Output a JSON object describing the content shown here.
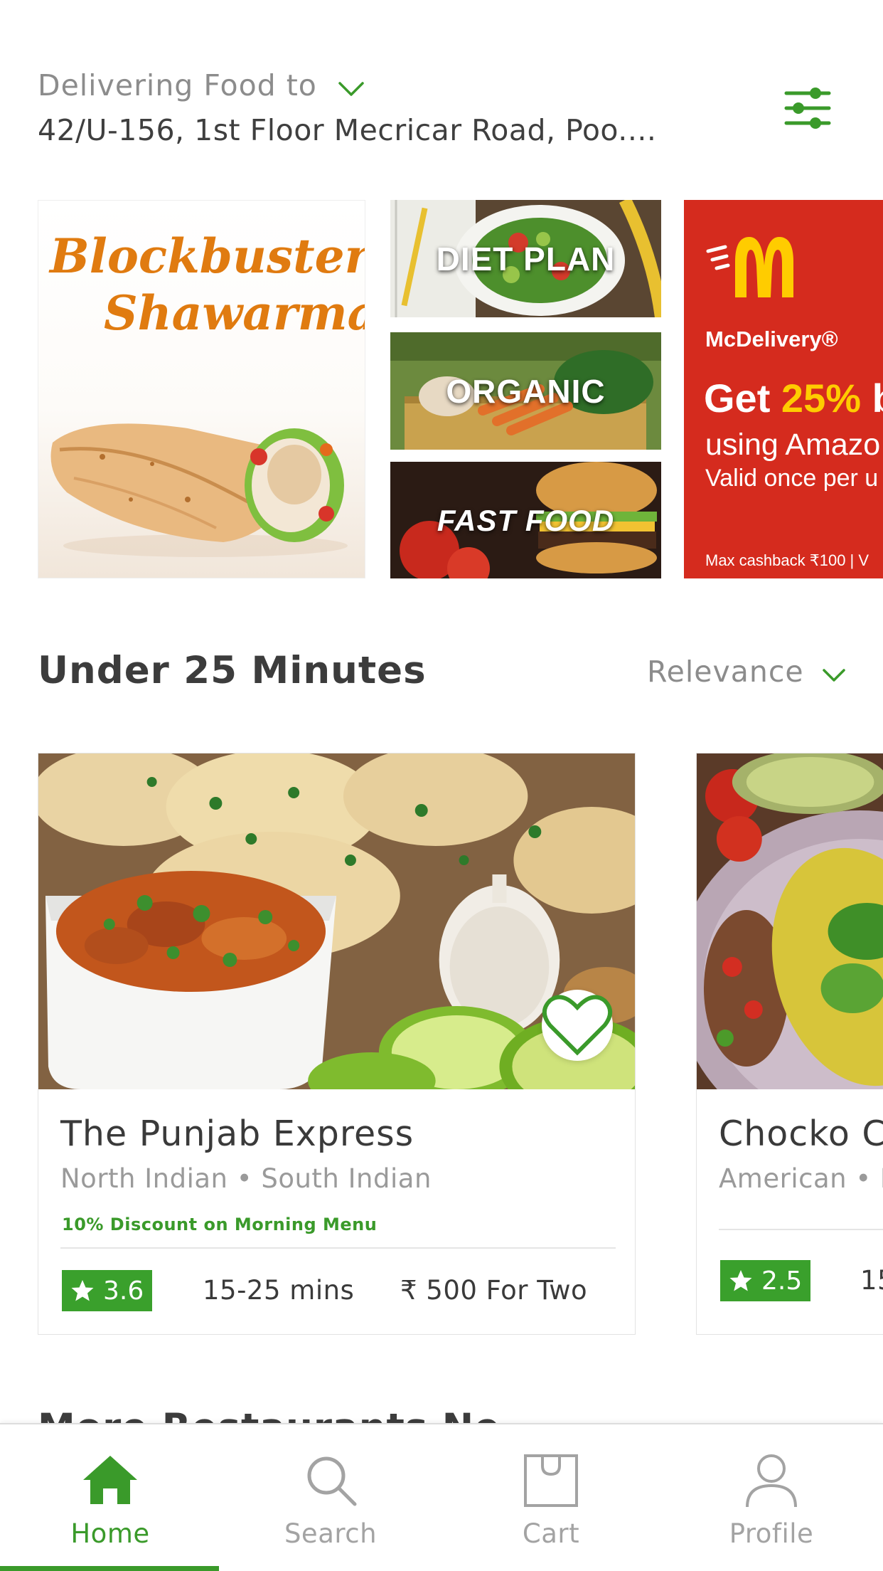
{
  "header": {
    "deliver_label": "Delivering Food to",
    "address": "42/U-156, 1st Floor Mecricar Road, Poo...."
  },
  "banners": {
    "promo1": {
      "line1": "Blockbuster",
      "line2": "Shawarma"
    },
    "categories": [
      "DIET PLAN",
      "ORGANIC",
      "FAST FOOD"
    ],
    "promo2": {
      "brand": "McDelivery®",
      "offer_prefix": "Get ",
      "offer_pct": "25%",
      "offer_suffix": " b",
      "line2": "using Amazo",
      "line3": "Valid once per u",
      "fine": "Max cashback ₹100 | V"
    }
  },
  "section": {
    "title": "Under 25 Minutes",
    "sort_label": "Relevance",
    "next_title": "More Restaurants Ne"
  },
  "restaurants": [
    {
      "name": "The Punjab Express",
      "cuisine": "North Indian • South Indian",
      "offer": "10% Discount on Morning Menu",
      "rating": "3.6",
      "time": "15-25 mins",
      "price": "₹ 500 For Two"
    },
    {
      "name": "Chocko Ch",
      "cuisine": "American • In",
      "rating": "2.5",
      "time": "15"
    }
  ],
  "nav": {
    "items": [
      {
        "label": "Home",
        "icon": "home-icon",
        "active": true
      },
      {
        "label": "Search",
        "icon": "search-icon",
        "active": false
      },
      {
        "label": "Cart",
        "icon": "cart-icon",
        "active": false
      },
      {
        "label": "Profile",
        "icon": "profile-icon",
        "active": false
      }
    ]
  },
  "colors": {
    "accent_green": "#3a9a2a",
    "rating_green": "#3aa02c",
    "mcd_red": "#d52b1e",
    "shawarma_orange": "#e07b10"
  }
}
